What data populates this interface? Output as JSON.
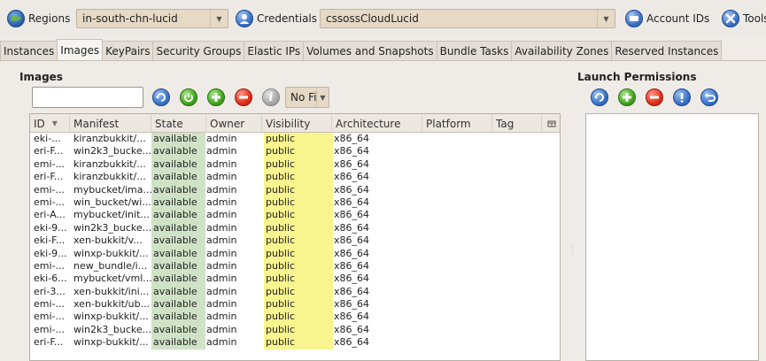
{
  "toolbar": {
    "regions_label": "Regions",
    "region_value": "in-south-chn-lucid",
    "credentials_label": "Credentials",
    "credentials_value": "cssossCloudLucid",
    "account_ids_label": "Account IDs",
    "tools_label": "Tools"
  },
  "tabs": [
    {
      "label": "Instances",
      "active": false
    },
    {
      "label": "Images",
      "active": true
    },
    {
      "label": "KeyPairs",
      "active": false
    },
    {
      "label": "Security Groups",
      "active": false
    },
    {
      "label": "Elastic IPs",
      "active": false
    },
    {
      "label": "Volumes and Snapshots",
      "active": false
    },
    {
      "label": "Bundle Tasks",
      "active": false
    },
    {
      "label": "Availability Zones",
      "active": false
    },
    {
      "label": "Reserved Instances",
      "active": false
    }
  ],
  "images": {
    "title": "Images",
    "search_value": "",
    "filter_value": "No Filt...",
    "columns": {
      "id": "ID",
      "manifest": "Manifest",
      "state": "State",
      "owner": "Owner",
      "visibility": "Visibility",
      "architecture": "Architecture",
      "platform": "Platform",
      "tag": "Tag"
    },
    "rows": [
      {
        "id": "eki-...",
        "manifest": "kiranzbukkit/...",
        "state": "available",
        "owner": "admin",
        "visibility": "public",
        "architecture": "x86_64",
        "platform": "",
        "tag": ""
      },
      {
        "id": "eri-F...",
        "manifest": "win2k3_bucke...",
        "state": "available",
        "owner": "admin",
        "visibility": "public",
        "architecture": "x86_64",
        "platform": "",
        "tag": ""
      },
      {
        "id": "emi-...",
        "manifest": "kiranzbukkit/...",
        "state": "available",
        "owner": "admin",
        "visibility": "public",
        "architecture": "x86_64",
        "platform": "",
        "tag": ""
      },
      {
        "id": "eri-F...",
        "manifest": "kiranzbukkit/...",
        "state": "available",
        "owner": "admin",
        "visibility": "public",
        "architecture": "x86_64",
        "platform": "",
        "tag": ""
      },
      {
        "id": "emi-...",
        "manifest": "mybucket/ima...",
        "state": "available",
        "owner": "admin",
        "visibility": "public",
        "architecture": "x86_64",
        "platform": "",
        "tag": ""
      },
      {
        "id": "emi-...",
        "manifest": "win_bucket/wi...",
        "state": "available",
        "owner": "admin",
        "visibility": "public",
        "architecture": "x86_64",
        "platform": "",
        "tag": ""
      },
      {
        "id": "eri-A...",
        "manifest": "mybucket/init...",
        "state": "available",
        "owner": "admin",
        "visibility": "public",
        "architecture": "x86_64",
        "platform": "",
        "tag": ""
      },
      {
        "id": "eki-9...",
        "manifest": "win2k3_bucke...",
        "state": "available",
        "owner": "admin",
        "visibility": "public",
        "architecture": "x86_64",
        "platform": "",
        "tag": ""
      },
      {
        "id": "eki-F...",
        "manifest": "xen-bukkit/v...",
        "state": "available",
        "owner": "admin",
        "visibility": "public",
        "architecture": "x86_64",
        "platform": "",
        "tag": ""
      },
      {
        "id": "eki-9...",
        "manifest": "winxp-bukkit/...",
        "state": "available",
        "owner": "admin",
        "visibility": "public",
        "architecture": "x86_64",
        "platform": "",
        "tag": ""
      },
      {
        "id": "emi-...",
        "manifest": "new_bundle/i...",
        "state": "available",
        "owner": "admin",
        "visibility": "public",
        "architecture": "x86_64",
        "platform": "",
        "tag": ""
      },
      {
        "id": "eki-6...",
        "manifest": "mybucket/vml...",
        "state": "available",
        "owner": "admin",
        "visibility": "public",
        "architecture": "x86_64",
        "platform": "",
        "tag": ""
      },
      {
        "id": "eri-3...",
        "manifest": "xen-bukkit/ini...",
        "state": "available",
        "owner": "admin",
        "visibility": "public",
        "architecture": "x86_64",
        "platform": "",
        "tag": ""
      },
      {
        "id": "emi-...",
        "manifest": "xen-bukkit/ub...",
        "state": "available",
        "owner": "admin",
        "visibility": "public",
        "architecture": "x86_64",
        "platform": "",
        "tag": ""
      },
      {
        "id": "emi-...",
        "manifest": "winxp-bukkit/...",
        "state": "available",
        "owner": "admin",
        "visibility": "public",
        "architecture": "x86_64",
        "platform": "",
        "tag": ""
      },
      {
        "id": "emi-...",
        "manifest": "win2k3_bucke...",
        "state": "available",
        "owner": "admin",
        "visibility": "public",
        "architecture": "x86_64",
        "platform": "",
        "tag": ""
      },
      {
        "id": "eri-F...",
        "manifest": "winxp-bukkit/...",
        "state": "available",
        "owner": "admin",
        "visibility": "public",
        "architecture": "x86_64",
        "platform": "",
        "tag": ""
      }
    ]
  },
  "launch_permissions": {
    "title": "Launch Permissions"
  },
  "colors": {
    "state_highlight": "#cfe2c6",
    "visibility_highlight": "#f8f48e",
    "combo_bg": "#e6d9c5"
  }
}
